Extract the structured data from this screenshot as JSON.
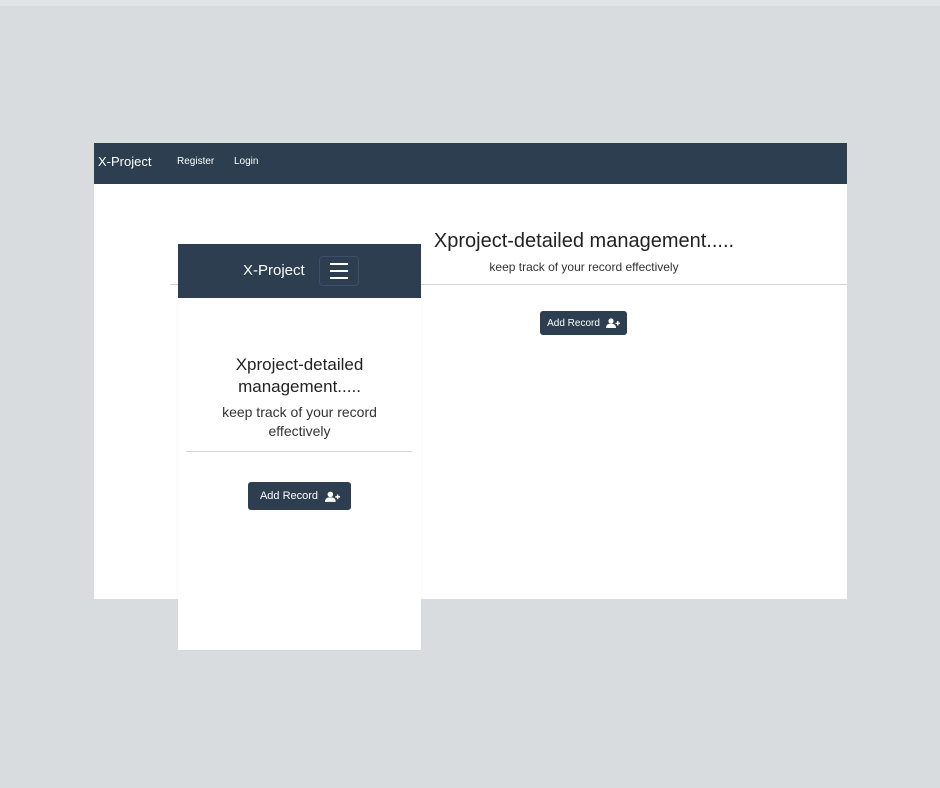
{
  "brand": "X-Project",
  "nav": {
    "register": "Register",
    "login": "Login"
  },
  "hero": {
    "title": "Xproject-detailed management.....",
    "title_mobile_line1": "Xproject-detailed",
    "title_mobile_line2": "management.....",
    "subtitle": "keep track of your record effectively",
    "subtitle_mobile_line1": "keep track of your record",
    "subtitle_mobile_line2": "effectively"
  },
  "buttons": {
    "add_record": "Add Record",
    "add_record_icon": "user-plus-icon",
    "menu_icon": "hamburger-icon"
  },
  "colors": {
    "navbar": "#2c3e50",
    "background": "#d9dcde",
    "button": "#2c3e50"
  }
}
